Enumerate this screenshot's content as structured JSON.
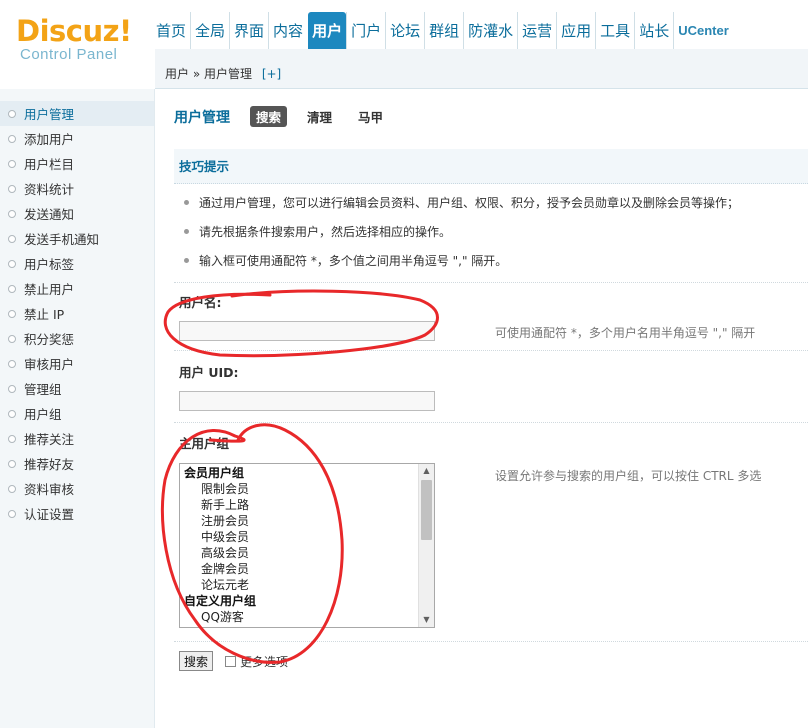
{
  "logo": {
    "main": "Discuz!",
    "sub": "Control Panel"
  },
  "nav": {
    "items": [
      {
        "label": "首页"
      },
      {
        "label": "全局"
      },
      {
        "label": "界面"
      },
      {
        "label": "内容"
      },
      {
        "label": "用户",
        "active": true
      },
      {
        "label": "门户"
      },
      {
        "label": "论坛"
      },
      {
        "label": "群组"
      },
      {
        "label": "防灌水"
      },
      {
        "label": "运营"
      },
      {
        "label": "应用"
      },
      {
        "label": "工具"
      },
      {
        "label": "站长"
      },
      {
        "label": "UCenter"
      }
    ]
  },
  "breadcrumb": {
    "text": "用户 » 用户管理",
    "add": "[+]"
  },
  "sidebar": {
    "items": [
      {
        "label": "用户管理",
        "active": true
      },
      {
        "label": "添加用户"
      },
      {
        "label": "用户栏目"
      },
      {
        "label": "资料统计"
      },
      {
        "label": "发送通知"
      },
      {
        "label": "发送手机通知"
      },
      {
        "label": "用户标签"
      },
      {
        "label": "禁止用户"
      },
      {
        "label": "禁止 IP"
      },
      {
        "label": "积分奖惩"
      },
      {
        "label": "审核用户"
      },
      {
        "label": "管理组"
      },
      {
        "label": "用户组"
      },
      {
        "label": "推荐关注"
      },
      {
        "label": "推荐好友"
      },
      {
        "label": "资料审核"
      },
      {
        "label": "认证设置"
      }
    ]
  },
  "main": {
    "title": "用户管理",
    "tabs": [
      {
        "label": "搜索",
        "active": true
      },
      {
        "label": "清理"
      },
      {
        "label": "马甲"
      }
    ],
    "tips": {
      "title": "技巧提示",
      "items": [
        "通过用户管理，您可以进行编辑会员资料、用户组、权限、积分，授予会员勋章以及删除会员等操作；",
        "请先根据条件搜索用户，然后选择相应的操作。",
        "输入框可使用通配符 *，多个值之间用半角逗号 \",\" 隔开。"
      ]
    },
    "username": {
      "label": "用户名:",
      "value": "",
      "hint": "可使用通配符 *，多个用户名用半角逗号 \",\" 隔开"
    },
    "uid": {
      "label": "用户 UID:",
      "value": ""
    },
    "groups": {
      "label": "主用户组",
      "hint": "设置允许参与搜索的用户组，可以按住 CTRL 多选",
      "options": [
        {
          "group": "会员用户组"
        },
        {
          "label": "限制会员"
        },
        {
          "label": "新手上路"
        },
        {
          "label": "注册会员"
        },
        {
          "label": "中级会员"
        },
        {
          "label": "高级会员"
        },
        {
          "label": "金牌会员"
        },
        {
          "label": "论坛元老"
        },
        {
          "group": "自定义用户组"
        },
        {
          "label": "QQ游客"
        }
      ]
    },
    "search_button": "搜索",
    "more_options": "更多选项"
  },
  "annotation_color": "#e8282a"
}
